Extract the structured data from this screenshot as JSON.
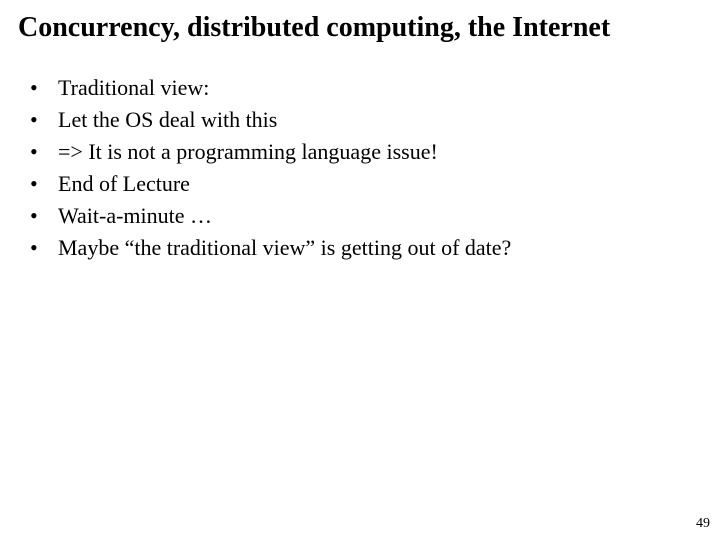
{
  "slide": {
    "title": "Concurrency, distributed computing, the Internet",
    "bullets": [
      "Traditional view:",
      "Let the OS deal with this",
      "=> It is not a programming language issue!",
      "End of Lecture",
      "Wait-a-minute …",
      "Maybe “the traditional view” is getting out of date?"
    ],
    "page_number": "49"
  }
}
